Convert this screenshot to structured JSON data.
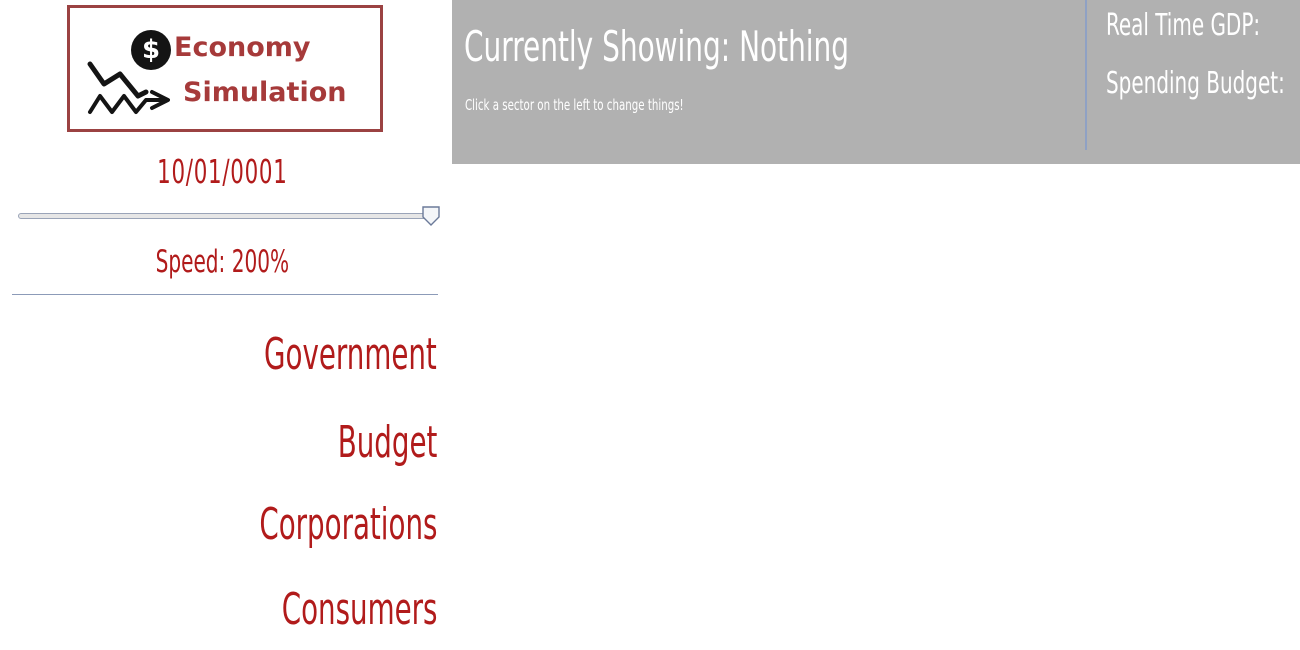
{
  "logo": {
    "line1": "Economy",
    "line2": "Simulation",
    "symbol": "$"
  },
  "sidebar": {
    "date": "10/01/0001",
    "speed_label": "Speed: 200%",
    "speed_value": 2.0,
    "nav": [
      "Government",
      "Budget",
      "Corporations",
      "Consumers"
    ]
  },
  "header": {
    "title": "Currently Showing: Nothing",
    "subtitle": "Click a sector on the left to change things!",
    "stat_gdp": "Real Time GDP:",
    "stat_budget": "Spending Budget:"
  },
  "colors": {
    "accent_red": "#b11b1b",
    "logo_red": "#a63a3a",
    "header_bg": "#b1b1b1"
  },
  "icons": [
    "dollar-coin-icon",
    "stock-chart-icon",
    "slider-thumb-icon"
  ]
}
